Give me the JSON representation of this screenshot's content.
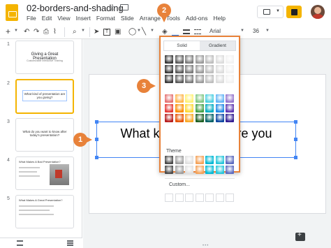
{
  "header": {
    "doc_title": "02-borders-and-shading",
    "menu": [
      "File",
      "Edit",
      "View",
      "Insert",
      "Format",
      "Slide",
      "Arrange",
      "Tools",
      "Add-ons",
      "Help"
    ]
  },
  "toolbar": {
    "font": "Arial",
    "size": "36"
  },
  "filmstrip": {
    "slides": [
      {
        "number": "1",
        "title": "Giving a Great Presentation",
        "subtitle": "Customizable Interactive Training"
      },
      {
        "number": "2",
        "title": "What kind of presentation are you giving?"
      },
      {
        "number": "3",
        "title": "What do you want to know after today's presentation?"
      },
      {
        "number": "4",
        "title": "What Makes A Bad Presentation?"
      },
      {
        "number": "5",
        "title": "What Makes A Great Presentation?"
      }
    ]
  },
  "slide": {
    "text_left": "What ki",
    "text_right": "on are you"
  },
  "color_menu": {
    "tab_solid": "Solid",
    "tab_gradient": "Gradient",
    "theme_label": "Theme",
    "custom_label": "Custom...",
    "gradient_grays": [
      "#3a3a3a",
      "#5a5a5a",
      "#7a7a7a",
      "#9a9a9a",
      "#bdbdbd",
      "#dcdcdc",
      "#f2f2f2"
    ],
    "gradient_rows": [
      [
        "#e57373",
        "#ffb74d",
        "#fff176",
        "#81c784",
        "#4dd0e1",
        "#64b5f6",
        "#9575cd"
      ],
      [
        "#e53935",
        "#fb8c00",
        "#fdd835",
        "#43a047",
        "#00acc1",
        "#1e88e5",
        "#5e35b1"
      ],
      [
        "#b71c1c",
        "#e65100",
        "#f9a825",
        "#1b5e20",
        "#006064",
        "#0d47a1",
        "#311b92"
      ]
    ],
    "theme_colors": [
      "#4a4a4a",
      "#9e9e9e",
      "#e0e0e0",
      "#f4a259",
      "#00b8d4",
      "#26c6da",
      "#5c6bc0"
    ]
  },
  "callouts": [
    "1",
    "2",
    "3"
  ],
  "colors": {
    "accent": "#e8823a",
    "selection": "#4285f4",
    "slides_yellow": "#f4b400"
  }
}
